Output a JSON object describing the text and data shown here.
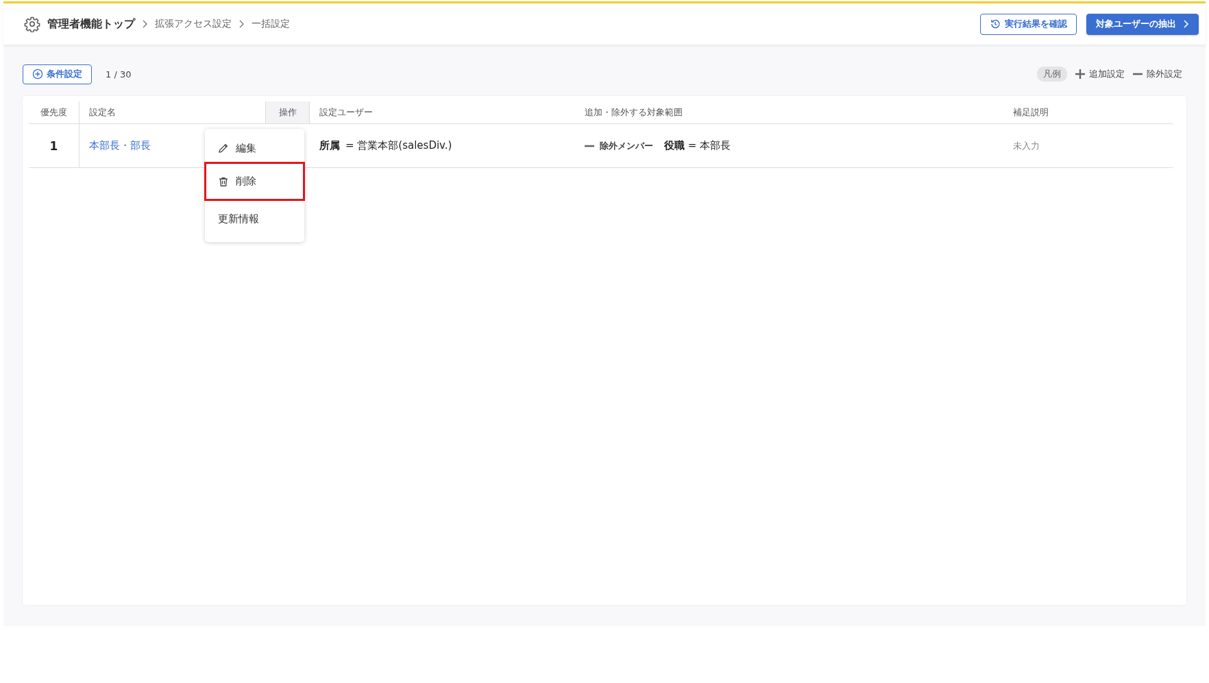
{
  "breadcrumb": [
    {
      "label": "管理者機能トップ",
      "kind": "home"
    },
    {
      "label": "拡張アクセス設定",
      "kind": "link"
    },
    {
      "label": "一括設定",
      "kind": "current"
    }
  ],
  "header_buttons": [
    {
      "label": "実行結果を確認",
      "kind": "history"
    },
    {
      "label": "対象ユーザーの抽出",
      "kind": "primary"
    }
  ],
  "toolbar": {
    "add_button": "条件設定",
    "count": "1 / 30"
  },
  "legend": {
    "title": "凡例",
    "items": [
      {
        "kind": "add",
        "label": "追加設定"
      },
      {
        "kind": "exclude",
        "label": "除外設定"
      }
    ]
  },
  "table": {
    "columns": [
      "優先度",
      "設定名",
      "操作",
      "設定ユーザー",
      "追加・除外する対象範囲",
      "補足説明"
    ],
    "rows": [
      {
        "priority": "1",
        "name": "本部長・部長",
        "user": "**所属** = 営業本部(salesDiv.)",
        "range": {
          "kind": "exclude",
          "label": "除外メンバー",
          "condition": "**役職** = 本部長"
        },
        "note": "未入力"
      }
    ]
  },
  "context_menu": [
    {
      "label": "編集",
      "kind": "edit",
      "highlighted": false
    },
    {
      "label": "削除",
      "kind": "delete",
      "highlighted": true
    },
    {
      "label": "更新情報",
      "kind": "info",
      "highlighted": false
    }
  ]
}
